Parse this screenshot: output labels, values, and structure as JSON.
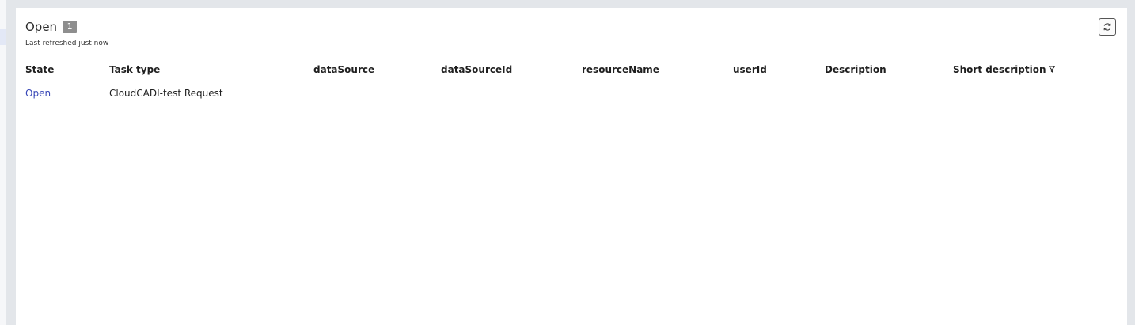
{
  "panel": {
    "title": "Open",
    "count": "1",
    "refreshed": "Last refreshed just now",
    "refresh_icon": "refresh-icon"
  },
  "table": {
    "columns": [
      "State",
      "Task type",
      "dataSource",
      "dataSourceId",
      "resourceName",
      "userId",
      "Description",
      "Short description"
    ],
    "filter_icon": "filter-icon",
    "rows": [
      {
        "state": "Open",
        "task_type": "CloudCADI-test Request",
        "dataSource": "",
        "dataSourceId": "",
        "resourceName": "",
        "userId": "",
        "description": "",
        "short_description": ""
      }
    ]
  },
  "colors": {
    "link": "#3a49b8",
    "badge": "#8e8e8e",
    "background": "#e3e6ea"
  }
}
